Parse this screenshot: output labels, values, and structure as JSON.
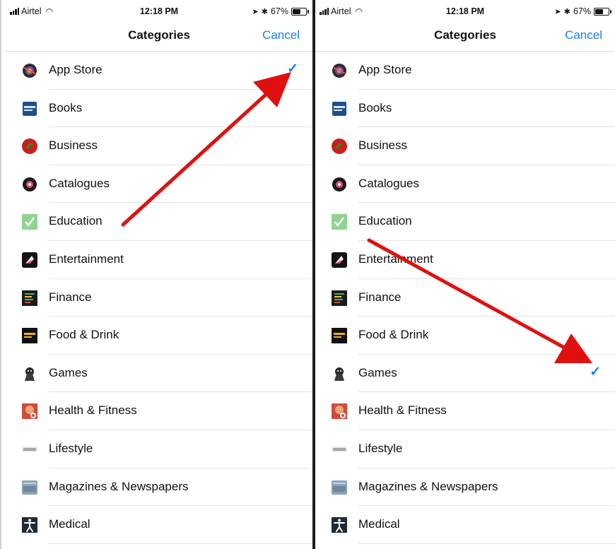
{
  "status": {
    "carrier": "Airtel",
    "time": "12:18 PM",
    "battery": "67%",
    "battery_level": 0.67
  },
  "nav": {
    "title": "Categories",
    "cancel": "Cancel"
  },
  "categories": [
    {
      "label": "App Store",
      "icon": "app-store-icon"
    },
    {
      "label": "Books",
      "icon": "books-icon"
    },
    {
      "label": "Business",
      "icon": "business-icon"
    },
    {
      "label": "Catalogues",
      "icon": "catalogues-icon"
    },
    {
      "label": "Education",
      "icon": "education-icon"
    },
    {
      "label": "Entertainment",
      "icon": "entertainment-icon"
    },
    {
      "label": "Finance",
      "icon": "finance-icon"
    },
    {
      "label": "Food & Drink",
      "icon": "food-drink-icon"
    },
    {
      "label": "Games",
      "icon": "games-icon"
    },
    {
      "label": "Health & Fitness",
      "icon": "health-fitness-icon"
    },
    {
      "label": "Lifestyle",
      "icon": "lifestyle-icon"
    },
    {
      "label": "Magazines & Newspapers",
      "icon": "magazines-newspapers-icon"
    },
    {
      "label": "Medical",
      "icon": "medical-icon"
    }
  ],
  "left_selected_index": 0,
  "right_selected_index": 8,
  "colors": {
    "accent": "#1a7cf4",
    "arrow": "#e01010"
  }
}
